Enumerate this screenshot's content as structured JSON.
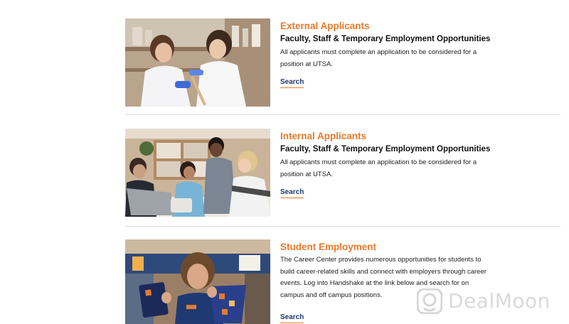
{
  "listings": [
    {
      "title": "External Applicants",
      "subtitle": "Faculty, Staff & Temporary Employment Opportunities",
      "body": "All applicants must complete an application to be considered for a position at UTSA.",
      "link": "Search"
    },
    {
      "title": "Internal Applicants",
      "subtitle": "Faculty, Staff & Temporary Employment Opportunities",
      "body": "All applicants must complete an application to be considered for a position at UTSA.",
      "link": "Search"
    },
    {
      "title": "Student Employment",
      "subtitle": "",
      "body": "The Career Center provides numerous opportunities for students to build career-related skills and connect with employers through career events.  Log into Handshake at the link below and search for on campus and off campus positions.",
      "link": "Search"
    }
  ],
  "watermark": {
    "text": "DealMoon"
  },
  "colors": {
    "title_orange": "#e87a2c",
    "link_navy": "#1f3a66",
    "divider": "#d9d9d9"
  }
}
